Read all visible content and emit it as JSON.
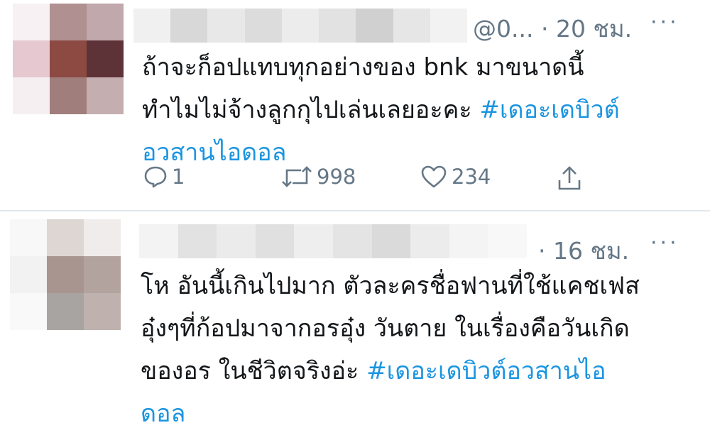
{
  "tweets": [
    {
      "handle": "@0...",
      "time": "· 20 ชม.",
      "more": "···",
      "text_lines": [
        {
          "plain": "ถ้าจะก็อปแทบทุกอย่างของ bnk มาขนาดนี้",
          "hashtag": ""
        },
        {
          "plain": "ทำไมไม่จ้างลูกกุไปเล่นเลยอะคะ ",
          "hashtag": "#เดอะเดบิวต์"
        },
        {
          "plain": "",
          "hashtag": "อวสานไอดอล"
        }
      ],
      "actions": {
        "replies": "1",
        "retweets": "998",
        "likes": "234"
      },
      "colors": {
        "icon": "#657786",
        "hashtag": "#1b95e0"
      }
    },
    {
      "handle": "",
      "time": "· 16 ชม.",
      "more": "···",
      "text_lines": [
        {
          "plain": "โห อันนี้เกินไปมาก ตัวละครชื่อฟานที่ใช้แคชเฟส",
          "hashtag": ""
        },
        {
          "plain": "อุ๋งๆที่ก้อปมาจากอรอุ๋ง วันตาย ในเรื่องคือวันเกิด",
          "hashtag": ""
        },
        {
          "plain": "ของอร ในชีวิตจริงอ่ะ ",
          "hashtag": "#เดอะเดบิวต์อวสานไอ"
        },
        {
          "plain": "",
          "hashtag": "ดอล"
        }
      ]
    }
  ]
}
